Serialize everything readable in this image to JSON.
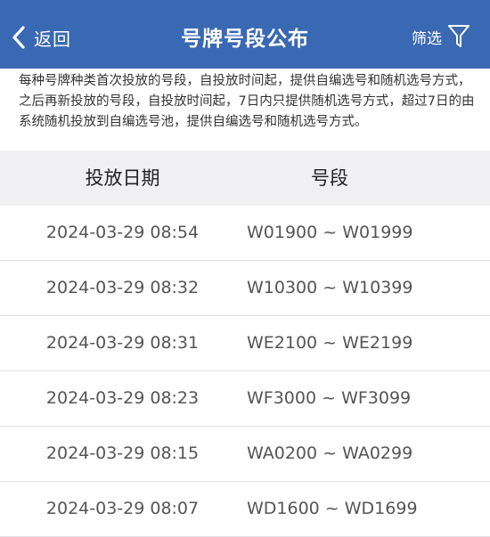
{
  "header": {
    "back_label": "返回",
    "title": "号牌号段公布",
    "filter_label": "筛选"
  },
  "notice": "每种号牌种类首次投放的号段，自投放时间起，提供自编选号和随机选号方式，之后再新投放的号段，自投放时间起，7日内只提供随机选号方式，超过7日的由系统随机投放到自编选号池，提供自编选号和随机选号方式。",
  "table": {
    "headers": {
      "date": "投放日期",
      "segment": "号段"
    },
    "rows": [
      {
        "date": "2024-03-29 08:54",
        "segment": "W01900 ~ W01999"
      },
      {
        "date": "2024-03-29 08:32",
        "segment": "W10300 ~ W10399"
      },
      {
        "date": "2024-03-29 08:31",
        "segment": "WE2100 ~ WE2199"
      },
      {
        "date": "2024-03-29 08:23",
        "segment": "WF3000 ~ WF3099"
      },
      {
        "date": "2024-03-29 08:15",
        "segment": "WA0200 ~ WA0299"
      },
      {
        "date": "2024-03-29 08:07",
        "segment": "WD1600 ~ WD1699"
      }
    ]
  },
  "colors": {
    "header_bg": "#3a69b4",
    "table_head_bg": "#f0f0f2"
  },
  "icons": {
    "back": "chevron-left-icon",
    "filter": "funnel-icon"
  }
}
